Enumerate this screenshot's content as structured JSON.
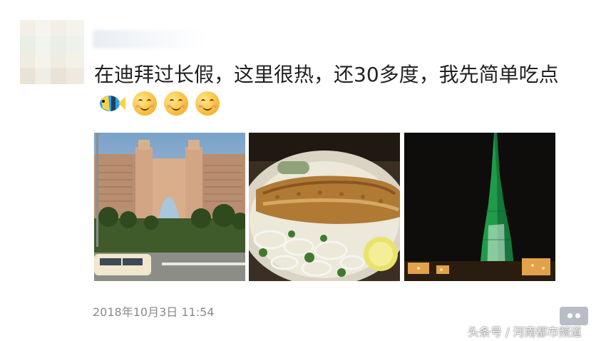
{
  "post": {
    "text": "在迪拜过长假，这里很热，还30多度，我先简单吃点",
    "emojis": [
      "tropical-fish",
      "smiling-face",
      "smiling-face",
      "smiling-face"
    ],
    "photos": [
      {
        "name": "atlantis-hotel-photo"
      },
      {
        "name": "grilled-fish-photo"
      },
      {
        "name": "burj-khalifa-photo"
      }
    ],
    "timestamp": "2018年10月3日 11:54"
  },
  "watermark": "头条号 / 河南都市频道",
  "colors": {
    "text": "#222222",
    "timestamp": "#8a8a8a",
    "comment_button": "#b9bdc6"
  }
}
